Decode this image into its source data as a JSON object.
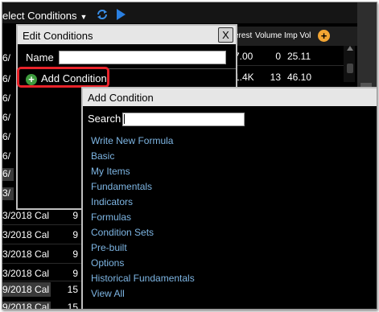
{
  "toolbar": {
    "select_conditions": "elect Conditions",
    "caret": "▼"
  },
  "grid": {
    "headers": [
      "erest",
      "Volume",
      "Imp Vol"
    ],
    "rows": [
      [
        "7.00",
        "0",
        "25.11"
      ],
      [
        "1.4K",
        "13",
        "46.10"
      ]
    ],
    "left_markers": [
      "6/",
      "6/",
      "6/",
      "6/",
      "6/",
      "6/",
      "6/",
      "3/",
      "3/"
    ],
    "bottom_rows": [
      {
        "date": "3/2018 Cal",
        "num": "9"
      },
      {
        "date": "3/2018 Cal",
        "num": "9"
      },
      {
        "date": "3/2018 Cal",
        "num": "9"
      },
      {
        "date": "3/2018 Cal",
        "num": "9"
      },
      {
        "date": "9/2018 Cal",
        "num": "15"
      },
      {
        "date": "9/2018 Cal",
        "num": "15"
      }
    ]
  },
  "edit_dialog": {
    "title": "Edit Conditions",
    "close_label": "X",
    "name_label": "Name",
    "name_value": "",
    "add_condition_label": "Add Condition",
    "add_condition_icon": "+"
  },
  "add_dialog": {
    "title": "Add Condition",
    "search_label": "Search",
    "search_value": "",
    "items": [
      "Write New Formula",
      "Basic",
      "My Items",
      "Fundamentals",
      "Indicators",
      "Formulas",
      "Condition Sets",
      "Pre-built",
      "Options",
      "Historical Fundamentals",
      "View All"
    ]
  },
  "colors": {
    "link": "#7eb6e4",
    "highlight": "#e8232a",
    "add_icon": "#3d9b3d",
    "plus_button": "#f3a533"
  }
}
